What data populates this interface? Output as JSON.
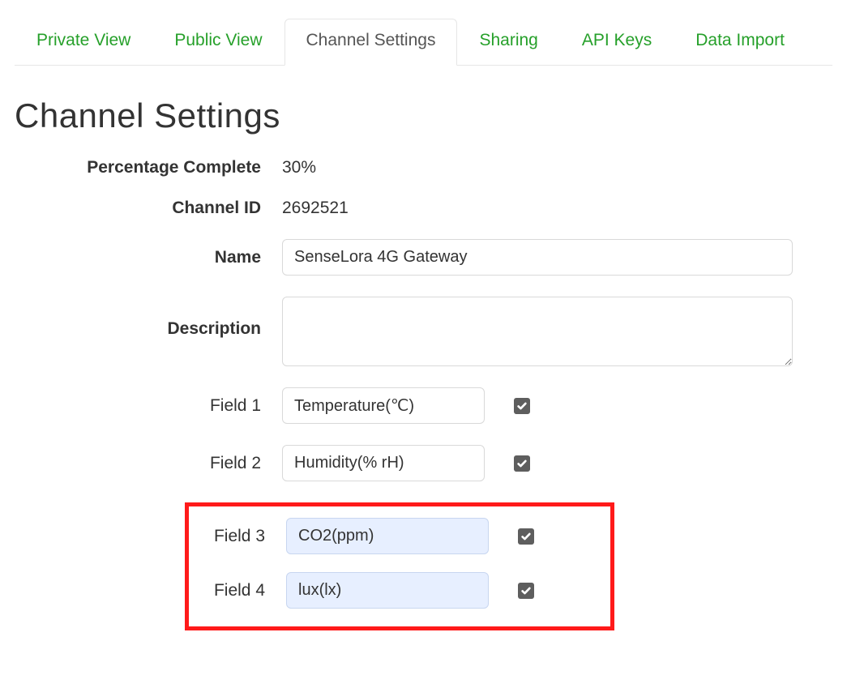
{
  "tabs": {
    "private_view": "Private View",
    "public_view": "Public View",
    "channel_settings": "Channel Settings",
    "sharing": "Sharing",
    "api_keys": "API Keys",
    "data_import": "Data Import"
  },
  "heading": "Channel Settings",
  "labels": {
    "percentage_complete": "Percentage Complete",
    "channel_id": "Channel ID",
    "name": "Name",
    "description": "Description",
    "field1": "Field 1",
    "field2": "Field 2",
    "field3": "Field 3",
    "field4": "Field 4"
  },
  "values": {
    "percentage_complete": "30%",
    "channel_id": "2692521",
    "name": "SenseLora 4G Gateway",
    "description": "",
    "field1": "Temperature(℃)",
    "field2": "Humidity(% rH)",
    "field3": "CO2(ppm)",
    "field4": "lux(lx)"
  },
  "field_enabled": {
    "field1": true,
    "field2": true,
    "field3": true,
    "field4": true
  }
}
